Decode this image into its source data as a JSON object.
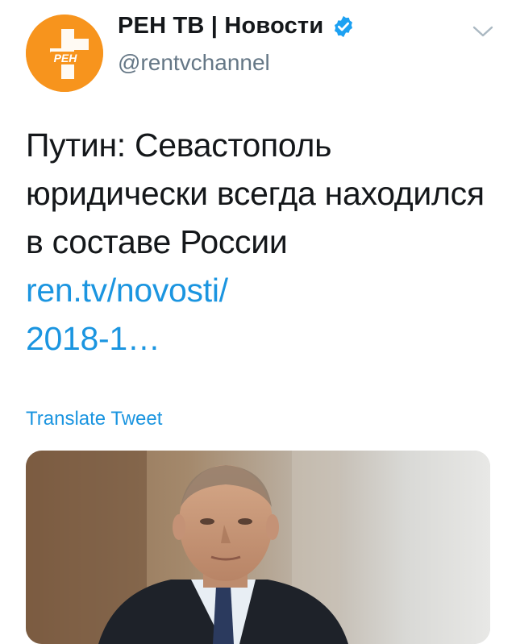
{
  "tweet": {
    "author": {
      "display_name": "РЕН ТВ | Новости",
      "handle": "@rentvchannel",
      "avatar_logo_text": "РЕН",
      "avatar_color": "#f7941d",
      "verified": true
    },
    "text": "Путин: Севастополь юридически всегда находился в составе России",
    "link_line1": "ren.tv/novosti/",
    "link_line2": "2018-1…",
    "translate_label": "Translate Tweet",
    "media": {
      "type": "photo",
      "icon": "photo-of-person"
    }
  },
  "colors": {
    "accent": "#1b95e0",
    "text": "#14171a",
    "secondary": "#657786"
  },
  "icons": {
    "verified": "verified-badge-icon",
    "menu": "chevron-down-icon"
  }
}
